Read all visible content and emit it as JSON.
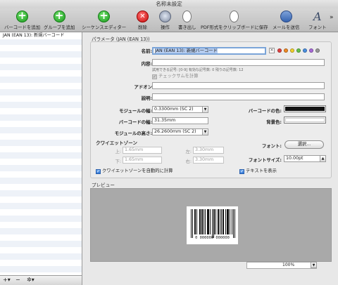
{
  "window": {
    "title": "名称未設定"
  },
  "toolbar": {
    "add_barcode": "バーコードを追加",
    "add_group": "グループを追加",
    "sequence_editor": "シーケンスエディター",
    "delete": "削除",
    "actions": "操作",
    "export": "書き出し",
    "copy_pdf": "PDF形式をクリップボードに保存",
    "email": "メールを送信",
    "font": "フォント",
    "overflow": "»"
  },
  "sidebar": {
    "items": [
      {
        "label": "JAN (EAN 13): 新規バーコード"
      }
    ],
    "footer": {
      "add": "+▾",
      "remove": "−",
      "action": "✲▾"
    }
  },
  "params": {
    "section_title": "パラメータ (JAN (EAN 13))",
    "name_label": "名前:",
    "name_value": "JAN (EAN 13): 新規バーコード",
    "content_label": "内容:",
    "content_value": "",
    "content_hint": "試用できる記号: [0-9]  有効な記号数: 0  残りの記号数: 12",
    "checksum_label": "チェックサムを計算",
    "addon_label": "アドオン",
    "description_label": "説明:",
    "module_width_label": "モジュールの幅:",
    "module_width_value": "0.3300mm (SC 2)",
    "barcode_width_label": "バーコードの幅:",
    "barcode_width_value": "31.35mm",
    "module_height_label": "モジュールの高さ:",
    "module_height_value": "26.2600mm (SC 2)",
    "barcode_color_label": "バーコードの色:",
    "background_color_label": "背景色:",
    "quiet_zone_title": "クワイエットゾーン",
    "qz_top_label": "上:",
    "qz_top_value": "1.65mm",
    "qz_left_label": "左:",
    "qz_left_value": "3.30mm",
    "qz_bottom_label": "下:",
    "qz_bottom_value": "1.65mm",
    "qz_right_label": "右:",
    "qz_right_value": "3.30mm",
    "auto_qz_label": "クワイエットゾーンを自動的に計算",
    "font_label": "フォント:",
    "font_button": "選択...",
    "font_size_label": "フォントサイズ:",
    "font_size_value": "10.00pt",
    "show_text_label": "テキストを表示"
  },
  "colors": {
    "barcode_color": "#111111",
    "background_color": "#ffffff",
    "label_dots": [
      "#e04040",
      "#f08a24",
      "#f2d12b",
      "#63c24a",
      "#4a90e2",
      "#a86ad8",
      "#9a9a9a"
    ]
  },
  "preview": {
    "section_title": "プレビュー",
    "barcode_text": "0 000000 000000",
    "zoom": "100%"
  }
}
